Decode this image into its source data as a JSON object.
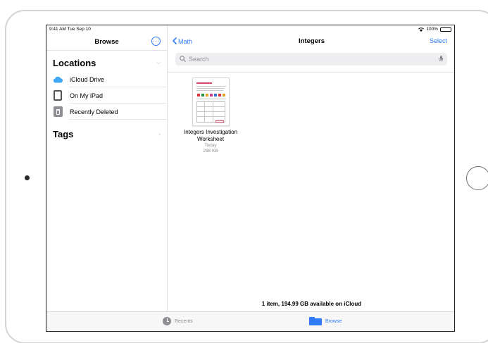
{
  "status_bar": {
    "time_date": "9:41 AM  Tue Sep 10",
    "battery": "100%",
    "icons": [
      "wifi-icon",
      "battery-icon"
    ]
  },
  "sidebar": {
    "title": "Browse",
    "more_icon": "ellipsis-circle-icon",
    "locations": {
      "title": "Locations",
      "items": [
        {
          "label": "iCloud Drive",
          "icon": "icloud-icon"
        },
        {
          "label": "On My iPad",
          "icon": "ipad-icon"
        },
        {
          "label": "Recently Deleted",
          "icon": "trash-icon"
        }
      ]
    },
    "tags": {
      "title": "Tags"
    }
  },
  "nav": {
    "back_label": "Math",
    "title": "Integers",
    "select_label": "Select"
  },
  "search": {
    "placeholder": "Search"
  },
  "files": [
    {
      "name": "Integers Investigation Worksheet",
      "date": "Today",
      "size": "298 KB"
    }
  ],
  "footer": {
    "status": "1 item, 194.99 GB available on iCloud"
  },
  "tab_bar": {
    "tabs": [
      {
        "label": "Recents",
        "icon": "clock-icon",
        "active": false
      },
      {
        "label": "Browse",
        "icon": "folder-icon",
        "active": true
      }
    ]
  },
  "colors": {
    "accent": "#2f7cf6",
    "secondary_text": "#8e8e93"
  }
}
